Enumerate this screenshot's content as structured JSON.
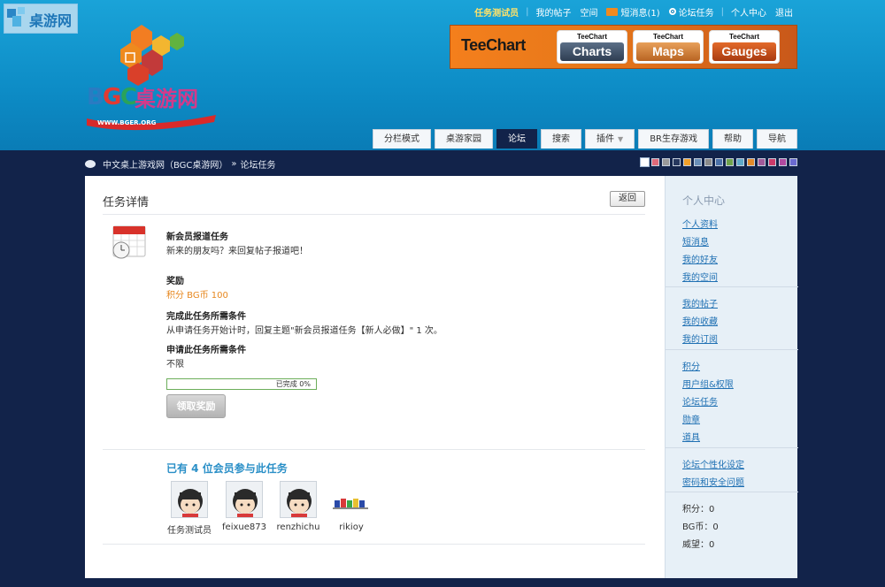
{
  "watermark": {
    "text": "桌游网"
  },
  "topbar": {
    "username": "任务测试员",
    "links": [
      "我的帖子",
      "空间"
    ],
    "messages": "短消息(1)",
    "tasks": "论坛任务",
    "user_center": "个人中心",
    "logout": "退出"
  },
  "logo": {
    "name": "BGC桌游网",
    "url": "WWW.BGER.ORG"
  },
  "banner": {
    "brand": "TeeChart",
    "products": [
      {
        "top": "TeeChart",
        "label": "Charts"
      },
      {
        "top": "TeeChart",
        "label": "Maps"
      },
      {
        "top": "TeeChart",
        "label": "Gauges"
      }
    ]
  },
  "nav": {
    "tabs": [
      "分栏模式",
      "桌游家园",
      "论坛",
      "搜索",
      "插件",
      "BR生存游戏",
      "帮助",
      "导航"
    ],
    "active": "论坛"
  },
  "breadcrumb": {
    "home": "中文桌上游戏网（BGC桌游网）",
    "separator": "»",
    "current": "论坛任务"
  },
  "theme_swatches": [
    "#ffffff",
    "#e06a7a",
    "#9a9a9a",
    "#26375e",
    "#f1a02a",
    "#6a8fb8",
    "#8a8a8a",
    "#4a70a8",
    "#6fa24c",
    "#5fa8c8",
    "#e28a2a",
    "#a25a9a",
    "#cc3a6a",
    "#b04aa0",
    "#6a6ad0"
  ],
  "task": {
    "page_title": "任务详情",
    "back_label": "返回",
    "name": "新会员报道任务",
    "description": "新来的朋友吗？来回复帖子报道吧！",
    "reward_label": "奖励",
    "reward_value": "积分 BG币 100",
    "complete_label": "完成此任务所需条件",
    "complete_value": "从申请任务开始计时，回复主题\"新会员报道任务【新人必做】\" 1 次。",
    "apply_label": "申请此任务所需条件",
    "apply_value": "不限",
    "progress_text": "已完成 0%",
    "progress": 0,
    "claim_label": "领取奖励",
    "participants_title": "已有 4 位会员参与此任务",
    "participants": [
      "任务测试员",
      "feixue873",
      "renzhichu",
      "rikioy"
    ]
  },
  "sidebar": {
    "title": "个人中心",
    "group1": [
      "个人资料",
      "短消息",
      "我的好友",
      "我的空间"
    ],
    "group2": [
      "我的帖子",
      "我的收藏",
      "我的订阅"
    ],
    "group3": [
      "积分",
      "用户组&权限",
      "论坛任务",
      "勋章",
      "道具"
    ],
    "group4": [
      "论坛个性化设定",
      "密码和安全问题"
    ],
    "stats": [
      "积分：0",
      "BG币：0",
      "威望：0"
    ]
  }
}
